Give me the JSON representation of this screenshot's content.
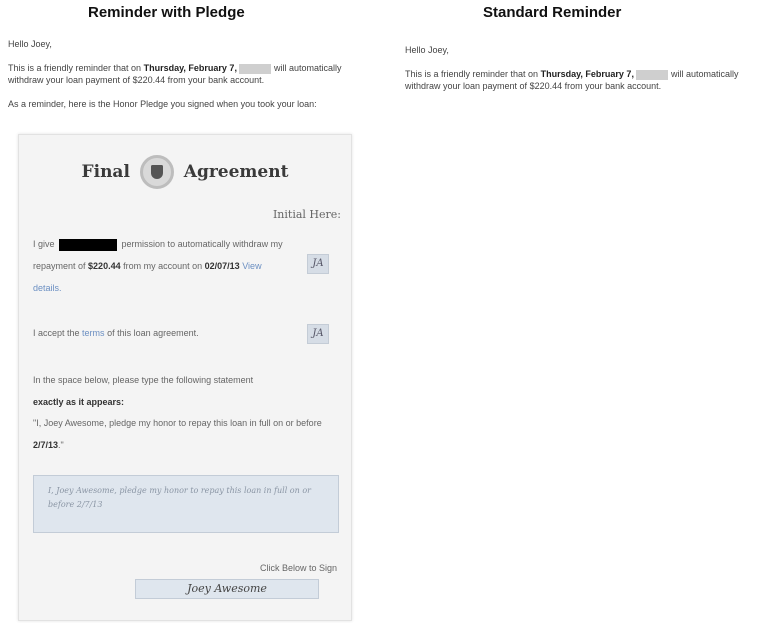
{
  "titles": {
    "left": "Reminder with Pledge",
    "right": "Standard Reminder"
  },
  "email": {
    "greeting": "Hello Joey,",
    "reminder_pre": "This is a friendly reminder that on",
    "date_bold": "Thursday, February 7,",
    "reminder_mid": "will",
    "reminder_post": "automatically withdraw your loan payment of $220.44 from your bank account.",
    "pledge_intro": "As a reminder, here is the Honor Pledge you signed when you took your loan:"
  },
  "card": {
    "title_left": "Final",
    "title_right": "Agreement",
    "initial_here": "Initial Here:",
    "p1_a": "I give",
    "p1_b": "permission to automatically withdraw my repayment of",
    "p1_amount": "$220.44",
    "p1_c": "from my account on",
    "p1_date": "02/07/13",
    "p1_link": "View details.",
    "p2_a": "I accept the",
    "p2_link": "terms",
    "p2_b": "of this loan agreement.",
    "p3_a": "In the space below, please type the following statement",
    "p3_bold": "exactly as it appears:",
    "p4_a": "\"I, Joey Awesome, pledge my honor to repay this loan in full on or before",
    "p4_date": "2/7/13",
    "p4_end": ".\"",
    "initials": "JA",
    "typed_pledge": "I, Joey Awesome, pledge my honor to repay this loan in full on or before 2/7/13",
    "click_below": "Click Below to Sign",
    "signature": "Joey Awesome"
  },
  "icons": {
    "seal": "shield-seal-icon"
  }
}
